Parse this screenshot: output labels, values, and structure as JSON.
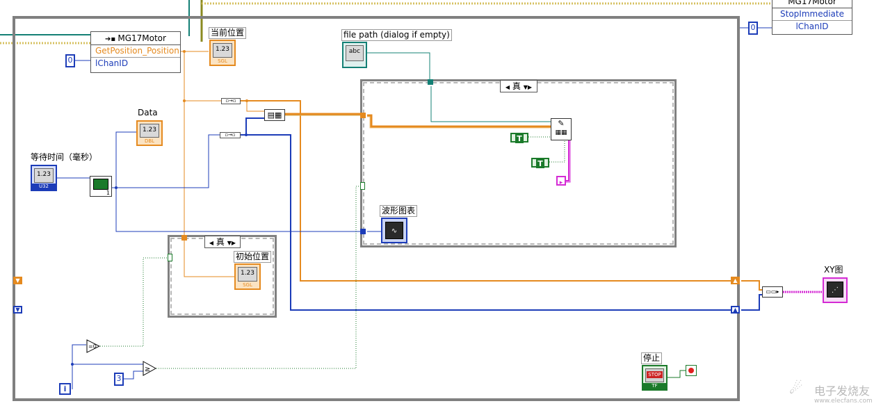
{
  "colors": {
    "orange": "#e58a1f",
    "blue": "#1c3cb8",
    "teal": "#138075",
    "green": "#1a7a2a",
    "pink": "#d42ad4",
    "olive": "#8a8a20",
    "loop_gray": "#808080"
  },
  "motor_node_left": {
    "title": "MG17Motor",
    "method": "GetPosition_Position",
    "param": "lChanID",
    "param_const": "0"
  },
  "motor_node_right": {
    "title": "MG17Motor",
    "method": "StopImmediate",
    "param": "lChanID",
    "param_const": "0"
  },
  "labels": {
    "current_position": "当前位置",
    "data": "Data",
    "wait_time": "等待时间（毫秒）",
    "file_path": "file path (dialog if empty)",
    "waveform_chart": "波形图表",
    "initial_position": "初始位置",
    "xy_graph": "XY图",
    "stop": "停止"
  },
  "indicators": {
    "current_position_value": "1.23",
    "current_position_type": "SGL",
    "data_value": "1.23",
    "data_type": "DBL",
    "wait_value": "1.23",
    "wait_type": "U32",
    "initial_position_value": "1.23",
    "initial_position_type": "SGL",
    "file_path_value": "abc",
    "stop_value": "STOP",
    "stop_type": "TF"
  },
  "case_structures": {
    "inner_case_selector": "真",
    "lower_case_selector": "真"
  },
  "constants": {
    "three": "3",
    "true_1": "T",
    "true_2": "T",
    "loop_index": "i",
    "elapsed_timer_out": "1"
  },
  "icons": {
    "bundle": "bundle-icon",
    "build_array": "build-array-icon",
    "write_file": "write-to-spreadsheet-icon",
    "wait": "wait-timer-icon",
    "equal_zero": "equal-zero-icon",
    "greater_equal": "greater-or-equal-icon",
    "stop_terminal": "stop-condition-icon",
    "xy_graph": "xy-graph-icon",
    "waveform": "waveform-chart-icon"
  },
  "watermark": {
    "brand": "电子发烧友",
    "url": "www.elecfans.com"
  }
}
